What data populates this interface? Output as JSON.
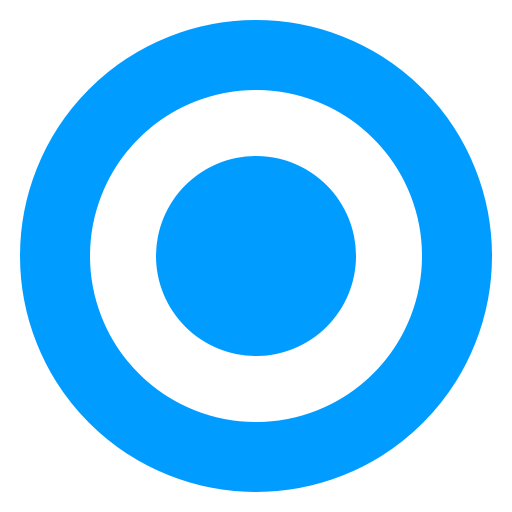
{
  "icon": {
    "name": "radio-button-selected-icon",
    "colors": {
      "primary": "#009CFF",
      "background": "#FFFFFF"
    }
  }
}
